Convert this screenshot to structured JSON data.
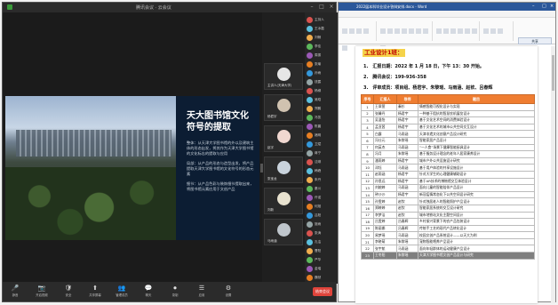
{
  "meeting": {
    "title": "腾讯会议 · 云会议",
    "slide": {
      "title": "天大图书馆文化符号的提取",
      "paragraphs": [
        "整体：从天津大学图书馆的外以及建筑主体的形态出发，将其作为天津大学图书馆的文化标志的提取与应用",
        "局部：从产品的形态与造型出发，将产品提取天津大学图书馆的文化符号的形态元素",
        "细节：从产品色彩与装饰细节提取出来，将图书馆元素应用于文创产品"
      ]
    },
    "video_tiles": [
      {
        "name": "主讲人(天津大学)"
      },
      {
        "name": "杨君宇"
      },
      {
        "name": "赵宇"
      },
      {
        "name": "张宝龙"
      },
      {
        "name": "刘新"
      },
      {
        "name": "马雨涵"
      }
    ],
    "members": [
      "主持人",
      "王冰霜",
      "刘畅",
      "李佳",
      "周振",
      "张瑜",
      "孙雨",
      "钱露",
      "杨柳",
      "吴晗",
      "郑鹏",
      "冯凯",
      "陈晨",
      "褚明",
      "卫斌",
      "蒋宁",
      "沈琪",
      "韩峰",
      "朱丹",
      "秦川",
      "许诺",
      "何旭",
      "吕阳",
      "施雨",
      "张涛",
      "孔洁",
      "曹阳",
      "严华",
      "金瑞",
      "魏然"
    ],
    "toolbar": [
      {
        "icon": "🎤",
        "label": "静音"
      },
      {
        "icon": "📷",
        "label": "开启视频"
      },
      {
        "icon": "🛡",
        "label": "安全"
      },
      {
        "icon": "⬆",
        "label": "共享屏幕"
      },
      {
        "icon": "👥",
        "label": "管理成员"
      },
      {
        "icon": "💬",
        "label": "聊天"
      },
      {
        "icon": "⏺",
        "label": "录制"
      },
      {
        "icon": "☰",
        "label": "应用"
      },
      {
        "icon": "⚙",
        "label": "设置"
      }
    ],
    "end_label": "结束会议"
  },
  "document": {
    "window_title": "2022届本科毕业设计答辩安排.docx - Word",
    "ribbon_tabs": [
      "文件",
      "开始",
      "插入",
      "设计",
      "布局",
      "引用",
      "邮件",
      "审阅",
      "视图",
      "帮助"
    ],
    "share_label": "共享",
    "heading": "工业设计1班：",
    "lines": [
      "1.　汇报日期：2022 年 1 月 18 日，下午 13：30 开始。",
      "2.　腾讯会议：199-936-358",
      "3.　评审成员：项目组、杨君宇、朱黎瑶、马雨涵、赵钦、吕春辉"
    ],
    "table": {
      "headers": [
        "序号",
        "汇报人",
        "导师",
        "题目"
      ],
      "rows": [
        [
          "1",
          "王翠萱",
          "秦杉",
          "情感智能可视化设计与实现"
        ],
        [
          "2",
          "张馨丹",
          "杨君宇",
          "一种基于阻抗的智慧农机展览设计"
        ],
        [
          "3",
          "吴温怡",
          "杨君宇",
          "基于文化艺术空间的消费体验设计"
        ],
        [
          "4",
          "孟亚茜",
          "杨君宇",
          "基于文化艺术的城市公共空间交互设计"
        ],
        [
          "5",
          "白露",
          "马雨涵",
          "天津非遗文化创意产品设计研究"
        ],
        [
          "6",
          "冯仕元",
          "朱黎瑶",
          "智能家居产品设计"
        ],
        [
          "7",
          "何英杰",
          "马雨涵",
          "“一人食”场景下健康智能厨具设计"
        ],
        [
          "8",
          "冯月",
          "朱黎瑶",
          "基于服务设计理念的老年人居家康养设计"
        ],
        [
          "9",
          "潘雨婷",
          "杨君宇",
          "城市户外公共设施设计研究"
        ],
        [
          "10",
          "邓钰",
          "马雨涵",
          "基于用户体验的共享设施设计"
        ],
        [
          "11",
          "赵雨涵",
          "杨君宇",
          "针对大学生的心理健康辅助设计"
        ],
        [
          "12",
          "孙思远",
          "杨君宇",
          "基于AR技术的博物馆交互体验设计"
        ],
        [
          "13",
          "刘婉婷",
          "马雨涵",
          "面向儿童的智能陪伴产品设计"
        ],
        [
          "14",
          "钟沙沙",
          "杨君宇",
          "新冠疫情常态化下公共空间设计研究"
        ],
        [
          "15",
          "孙雯婷",
          "赵钦",
          "针对独居老人的智能照护产品设计"
        ],
        [
          "16",
          "郑婷婷",
          "赵钦",
          "智能家居系统的交互设计研究"
        ],
        [
          "17",
          "李梦洁",
          "赵钦",
          "城市地铁站文化主题空间设计"
        ],
        [
          "18",
          "吕雯婷",
          "吕春辉",
          "乡村振兴背景下的农产品包装设计"
        ],
        [
          "19",
          "陈丽娜",
          "吕春辉",
          "传统手工艺的现代产品转化设计"
        ],
        [
          "20",
          "易梦瑶",
          "马雨涵",
          "校园文创产品系统设计——以天大为例"
        ],
        [
          "21",
          "李晓萌",
          "朱黎瑶",
          "宠物智能喂养产品设计"
        ],
        [
          "22",
          "张宇航",
          "马雨涵",
          "面向年轻群体的运动健康产品设计"
        ],
        [
          "23",
          "王冬阳",
          "朱黎瑶",
          "天津大学图书馆文创产品设计与研究"
        ]
      ],
      "highlight_row": 23
    }
  },
  "colors": {
    "table_header": "#ef7d31",
    "heading_bg": "#f5d34a",
    "heading_text": "#c00000",
    "word_blue": "#2b579a",
    "end_button": "#e0443b"
  }
}
